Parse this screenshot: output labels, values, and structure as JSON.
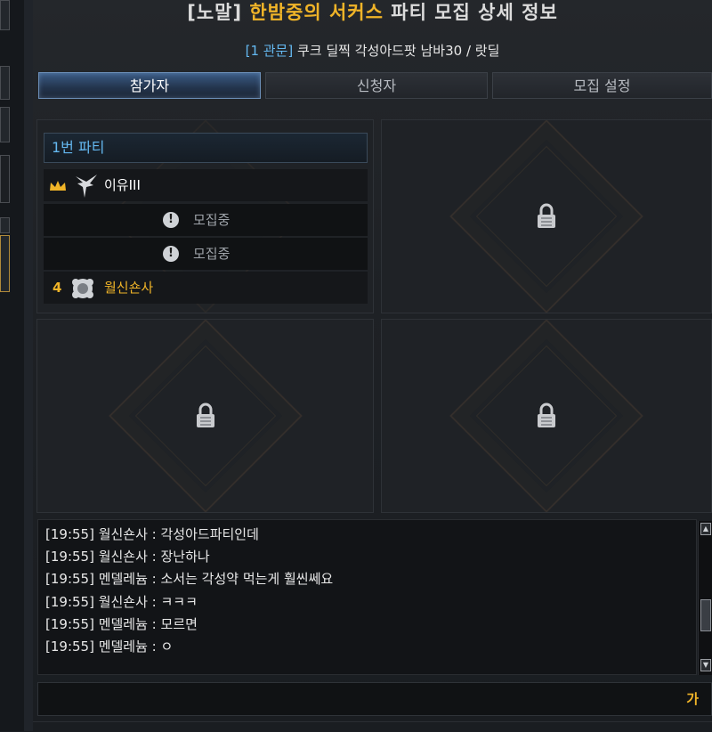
{
  "window": {
    "title_prefix": "[노말]",
    "guild_name": "한밤중의 서커스",
    "title_suffix": "파티 모집 상세 정보"
  },
  "recruit": {
    "tag": "[1 관문]",
    "description": "쿠크 딜찍 각성아드팟 남바30 / 랏딜"
  },
  "tabs": [
    {
      "label": "참가자",
      "active": true
    },
    {
      "label": "신청자",
      "active": false
    },
    {
      "label": "모집 설정",
      "active": false
    }
  ],
  "party": {
    "title": "1번 파티",
    "members": [
      {
        "name": "이유III",
        "status": "leader",
        "name_color": "#ffffff",
        "icon": "crown-icon"
      },
      {
        "name": "",
        "status": "recruiting",
        "label": "모집중"
      },
      {
        "name": "",
        "status": "recruiting",
        "label": "모집중"
      },
      {
        "name": "월신숀사",
        "status": "member",
        "number": "4",
        "name_color": "#f0b428",
        "icon": "class-emblem-icon"
      }
    ]
  },
  "chat": {
    "lines": [
      "[19:55] 월신숀사 : 각성아드파티인데",
      "[19:55] 월신숀사 : 장난하나",
      "[19:55] 멘델레늄 : 소서는 각성약 먹는게 훨씬쎄요",
      "[19:55] 월신숀사 : ㅋㅋㅋ",
      "[19:55] 멘델레늄 : 모르면",
      "[19:55] 멘델레늄 : ㅇ"
    ],
    "input_value": "",
    "ime_indicator": "가"
  },
  "colors": {
    "accent_gold": "#f0b428",
    "accent_blue": "#64b8f0"
  }
}
